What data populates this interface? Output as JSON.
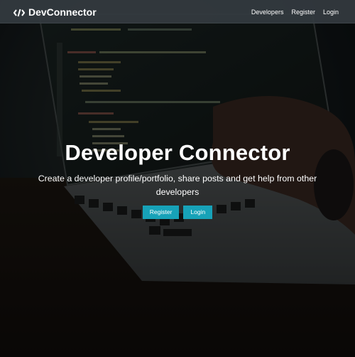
{
  "navbar": {
    "brand": "DevConnector",
    "brand_icon": "code-icon",
    "links": [
      "Developers",
      "Register",
      "Login"
    ]
  },
  "landing": {
    "title": "Developer Connector",
    "lead": "Create a developer profile/portfolio, share posts and get help from other developers",
    "buttons": {
      "register": "Register",
      "login": "Login"
    }
  },
  "colors": {
    "navbar_bg": "#343a40",
    "button": "#17a2b8",
    "text": "#ffffff"
  }
}
